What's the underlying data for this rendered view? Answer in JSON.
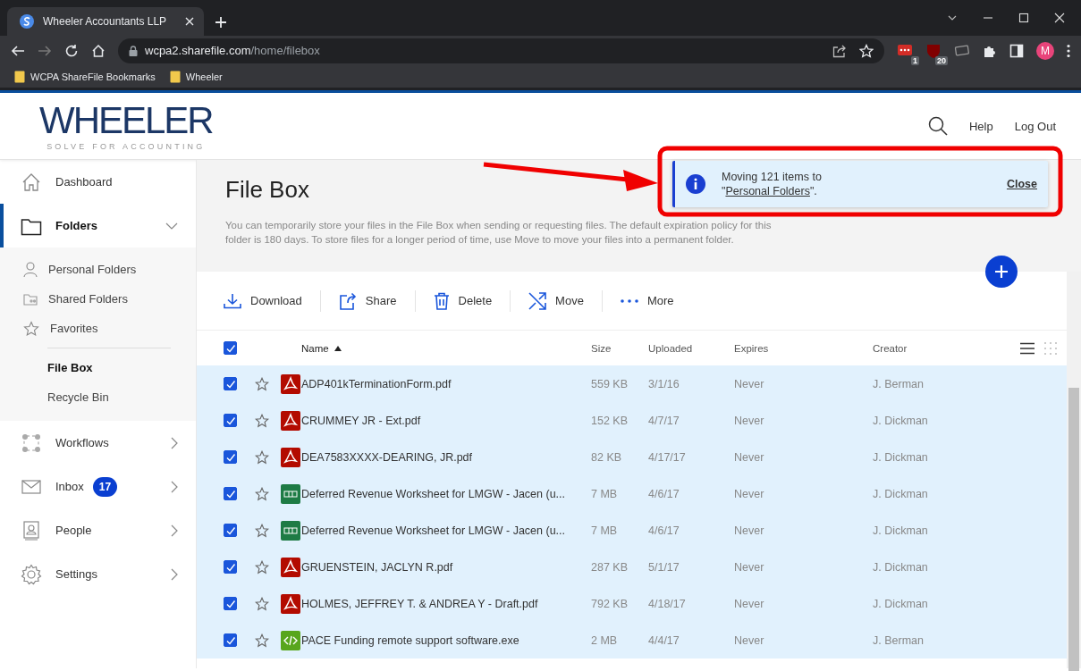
{
  "browser": {
    "tab_title": "Wheeler Accountants LLP",
    "url_host": "wcpa2.sharefile.com",
    "url_path": "/home/filebox",
    "bookmarks": [
      "WCPA ShareFile Bookmarks",
      "Wheeler"
    ],
    "extensions": [
      {
        "kind": "lastpass",
        "badge": "1"
      },
      {
        "kind": "ublock",
        "badge": "20"
      },
      {
        "kind": "ticket"
      }
    ],
    "profile_initial": "M"
  },
  "header": {
    "logo_text": "WHEELER",
    "tagline": "SOLVE FOR ACCOUNTING",
    "links": [
      "Help",
      "Log Out"
    ]
  },
  "sidebar": {
    "items": [
      {
        "kind": "dashboard",
        "label": "Dashboard",
        "selected": false
      },
      {
        "kind": "folders",
        "label": "Folders",
        "selected": true,
        "expanded": true,
        "children": [
          {
            "kind": "personal",
            "label": "Personal Folders",
            "selected": false
          },
          {
            "kind": "shared",
            "label": "Shared Folders",
            "selected": false
          },
          {
            "kind": "favorites",
            "label": "Favorites",
            "selected": false
          },
          {
            "kind": "plain",
            "label": "File Box",
            "selected": true
          },
          {
            "kind": "plain",
            "label": "Recycle Bin",
            "selected": false
          }
        ]
      },
      {
        "kind": "workflows",
        "label": "Workflows",
        "selected": false,
        "expanded": false
      },
      {
        "kind": "inbox",
        "label": "Inbox",
        "badge": "17",
        "selected": false,
        "expanded": false
      },
      {
        "kind": "people",
        "label": "People",
        "selected": false,
        "expanded": false
      },
      {
        "kind": "settings",
        "label": "Settings",
        "selected": false,
        "expanded": false
      }
    ]
  },
  "main": {
    "title": "File Box",
    "description": "You can temporarily store your files in the File Box when sending or requesting files. The default expiration policy for this folder is 180 days. To store files for a longer period of time, use Move to move your files into a permanent folder.",
    "actions": [
      {
        "kind": "download",
        "label": "Download"
      },
      {
        "kind": "share",
        "label": "Share"
      },
      {
        "kind": "delete",
        "label": "Delete"
      },
      {
        "kind": "move",
        "label": "Move"
      },
      {
        "kind": "more",
        "label": "More"
      }
    ],
    "table": {
      "all_checked": true,
      "columns": [
        {
          "label": "Name",
          "sorted": true
        },
        {
          "label": "Size",
          "sorted": false
        },
        {
          "label": "Uploaded",
          "sorted": false
        },
        {
          "label": "Expires",
          "sorted": false
        },
        {
          "label": "Creator",
          "sorted": false
        }
      ],
      "rows": [
        {
          "kind": "pdf",
          "checked": true,
          "starred": false,
          "name": "ADP401kTerminationForm.pdf",
          "size": "559 KB",
          "uploaded": "3/1/16",
          "expires": "Never",
          "creator": "J. Berman"
        },
        {
          "kind": "pdf",
          "checked": true,
          "starred": false,
          "name": "CRUMMEY JR - Ext.pdf",
          "size": "152 KB",
          "uploaded": "4/7/17",
          "expires": "Never",
          "creator": "J. Dickman"
        },
        {
          "kind": "pdf",
          "checked": true,
          "starred": false,
          "name": "DEA7583XXXX-DEARING, JR.pdf",
          "size": "82 KB",
          "uploaded": "4/17/17",
          "expires": "Never",
          "creator": "J. Dickman"
        },
        {
          "kind": "xls",
          "checked": true,
          "starred": false,
          "name": "Deferred Revenue Worksheet for LMGW - Jacen (u...",
          "size": "7 MB",
          "uploaded": "4/6/17",
          "expires": "Never",
          "creator": "J. Dickman"
        },
        {
          "kind": "xls",
          "checked": true,
          "starred": false,
          "name": "Deferred Revenue Worksheet for LMGW - Jacen (u...",
          "size": "7 MB",
          "uploaded": "4/6/17",
          "expires": "Never",
          "creator": "J. Dickman"
        },
        {
          "kind": "pdf",
          "checked": true,
          "starred": false,
          "name": "GRUENSTEIN, JACLYN R.pdf",
          "size": "287 KB",
          "uploaded": "5/1/17",
          "expires": "Never",
          "creator": "J. Dickman"
        },
        {
          "kind": "pdf",
          "checked": true,
          "starred": false,
          "name": "HOLMES, JEFFREY T. & ANDREA Y - Draft.pdf",
          "size": "792 KB",
          "uploaded": "4/18/17",
          "expires": "Never",
          "creator": "J. Dickman"
        },
        {
          "kind": "exe",
          "checked": true,
          "starred": false,
          "name": "PACE Funding remote support software.exe",
          "size": "2 MB",
          "uploaded": "4/4/17",
          "expires": "Never",
          "creator": "J. Berman"
        }
      ]
    }
  },
  "notification": {
    "text_before": "Moving 121 items to",
    "quote_open": "\"",
    "link": "Personal Folders",
    "text_after": "\".",
    "close": "Close"
  }
}
